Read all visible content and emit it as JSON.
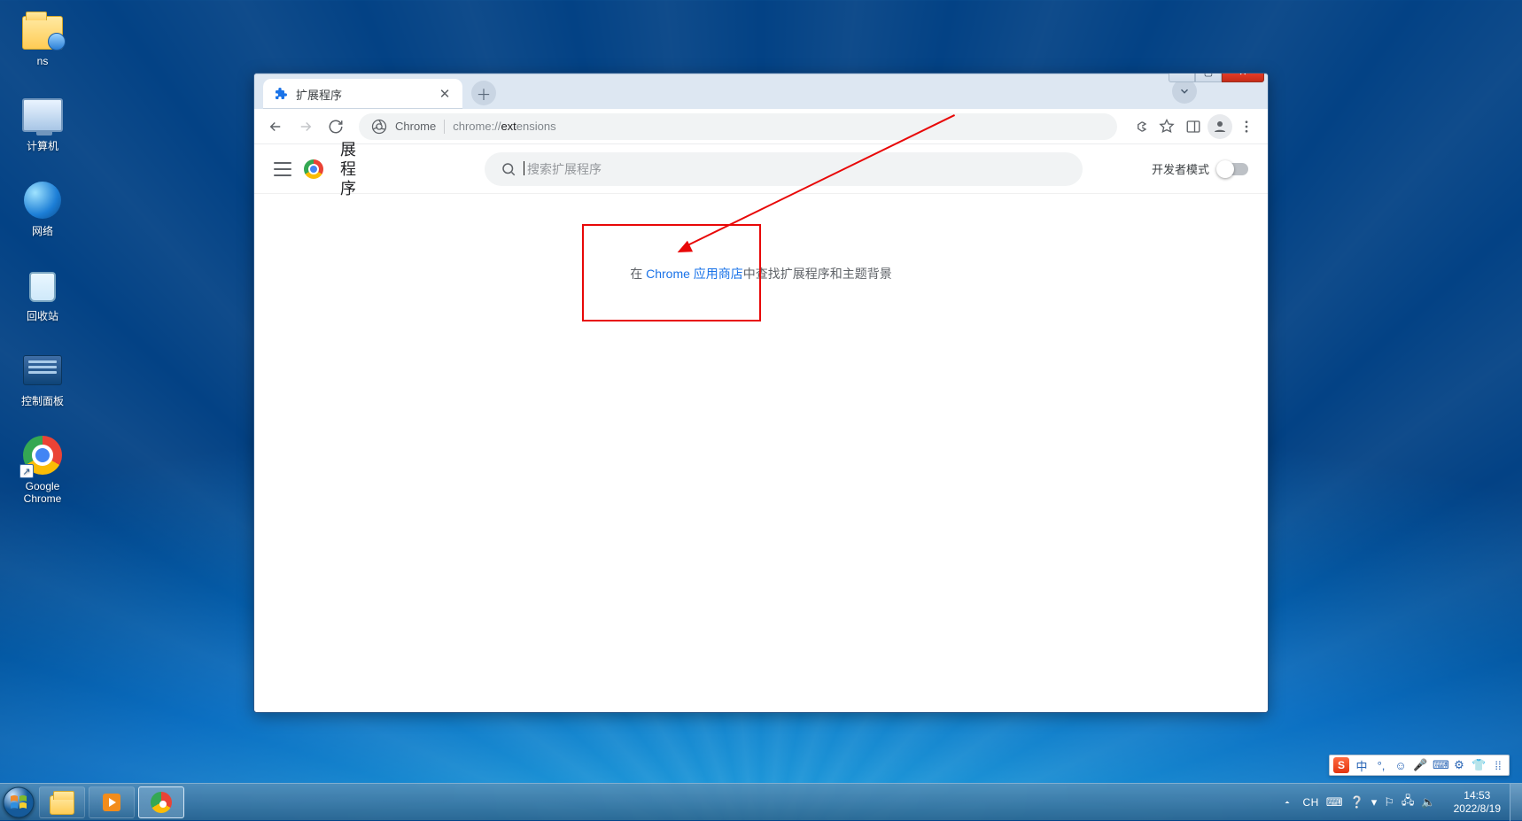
{
  "desktop": {
    "icons": [
      {
        "name": "ns-folder",
        "label": "ns"
      },
      {
        "name": "computer",
        "label": "计算机"
      },
      {
        "name": "network",
        "label": "网络"
      },
      {
        "name": "recycle-bin",
        "label": "回收站"
      },
      {
        "name": "control-panel",
        "label": "控制面板"
      },
      {
        "name": "chrome",
        "label": "Google\nChrome"
      }
    ]
  },
  "chrome": {
    "tab": {
      "title": "扩展程序"
    },
    "omnibox": {
      "chip": "Chrome",
      "url_prefix": "chrome://",
      "url_bold": "ext",
      "url_rest": "ensions"
    },
    "ext_page": {
      "title_vertical": "展程序",
      "search_placeholder": "搜索扩展程序",
      "dev_mode_label": "开发者模式",
      "message_pre": "在 ",
      "message_link": "Chrome 应用商店",
      "message_post": "中查找扩展程序和主题背景"
    }
  },
  "ime": {
    "logo": "S",
    "lang": "中",
    "items": [
      "°,",
      "☺",
      "🎤",
      "⌨",
      "⚙",
      "👕",
      "⁞⁞"
    ]
  },
  "tray": {
    "lang_code": "CH",
    "time": "14:53",
    "date": "2022/8/19"
  },
  "annotation": {
    "color": "#e80808"
  }
}
